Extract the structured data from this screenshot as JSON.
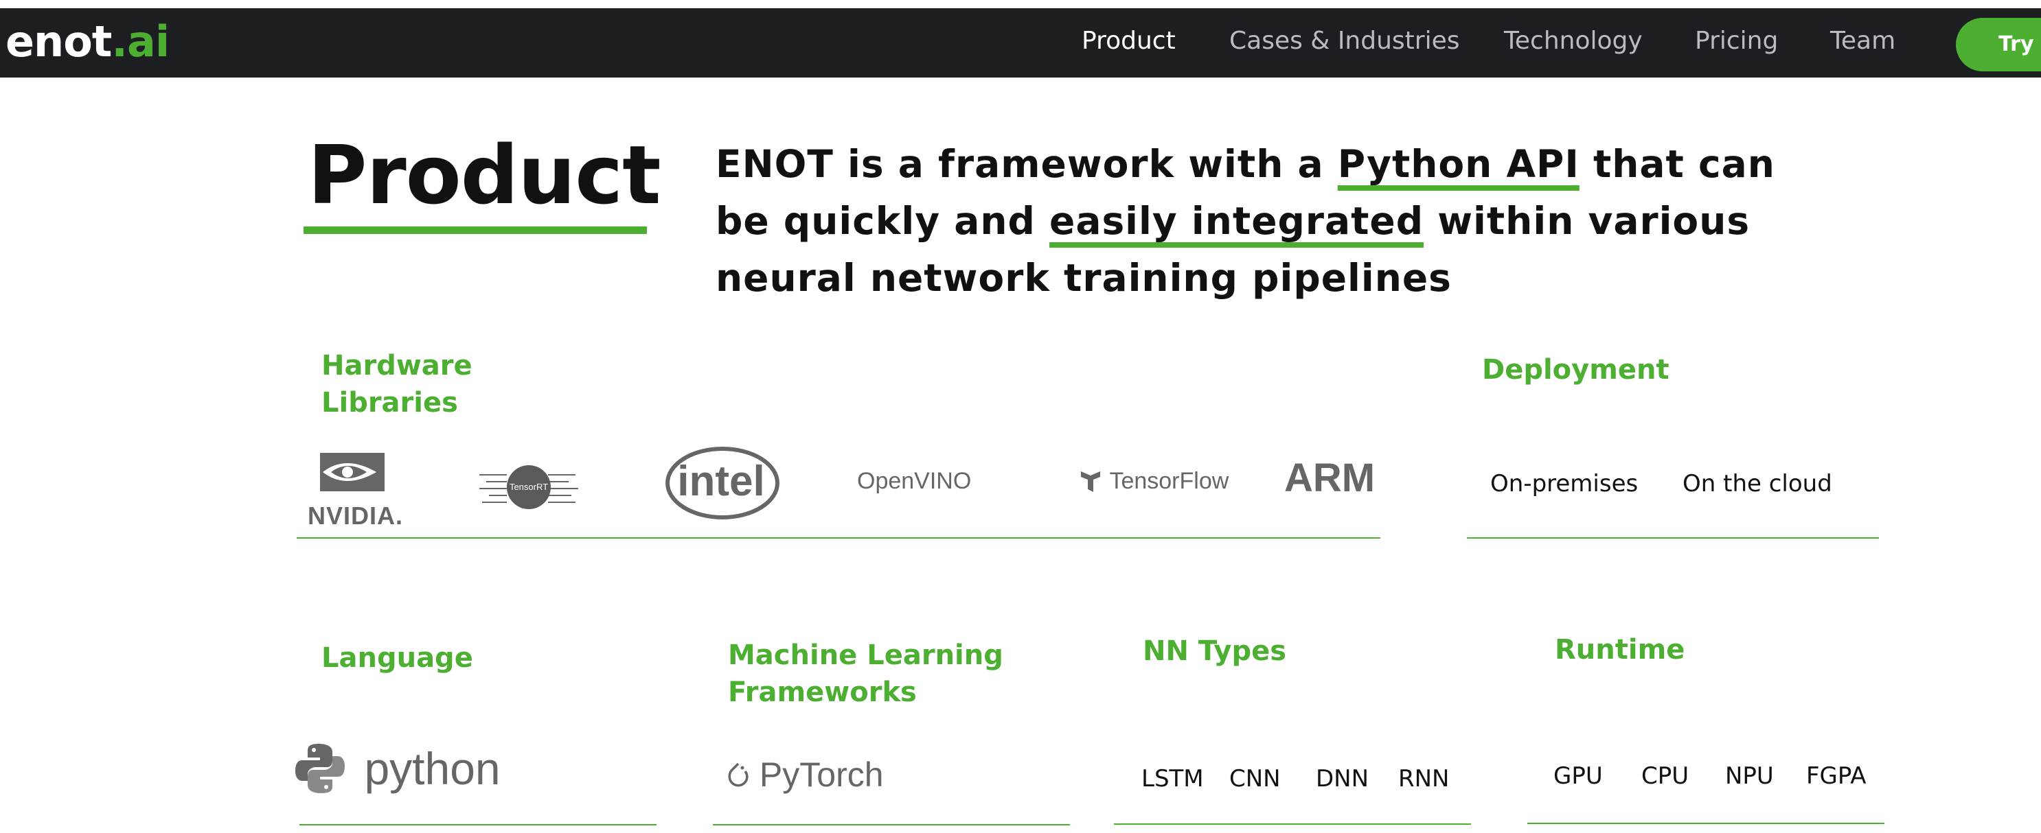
{
  "brand": {
    "name": "enot",
    "dot": ".",
    "tld": "ai"
  },
  "nav": {
    "items": [
      {
        "label": "Product"
      },
      {
        "label": "Cases & Industries"
      },
      {
        "label": "Technology"
      },
      {
        "label": "Pricing"
      },
      {
        "label": "Team"
      }
    ],
    "cta_label": "Try f"
  },
  "hero": {
    "title": "Product",
    "intro": {
      "part1": "ENOT is a framework with a ",
      "highlight1": "Python API",
      "part2": " that can be quickly and ",
      "highlight2": "easily integrated",
      "part3": " within various neural network training pipelines"
    }
  },
  "sections": {
    "hardware": {
      "heading": "Hardware Libraries",
      "logos": [
        {
          "label": "NVIDIA.",
          "icon": "nvidia-logo"
        },
        {
          "label": "TensorRT",
          "icon": "tensorrt-logo"
        },
        {
          "label": "intel",
          "icon": "intel-logo"
        },
        {
          "label": "OpenVINO",
          "icon": "openvino-logo"
        },
        {
          "label": "TensorFlow",
          "icon": "tensorflow-logo"
        },
        {
          "label": "ARM",
          "icon": "arm-logo"
        }
      ]
    },
    "deployment": {
      "heading": "Deployment",
      "items": [
        "On-premises",
        "On the cloud"
      ]
    },
    "language": {
      "heading": "Language",
      "logos": [
        {
          "label": "python",
          "icon": "python-logo"
        }
      ]
    },
    "ml_frameworks": {
      "heading": "Machine Learning Frameworks",
      "logos": [
        {
          "label": "PyTorch",
          "icon": "pytorch-logo"
        }
      ]
    },
    "nn_types": {
      "heading": "NN Types",
      "items": [
        "LSTM",
        "CNN",
        "DNN",
        "RNN"
      ]
    },
    "runtime": {
      "heading": "Runtime",
      "items": [
        "GPU",
        "CPU",
        "NPU",
        "FGPA"
      ]
    }
  },
  "colors": {
    "accent": "#4caf32",
    "navbar_bg": "#1c1e21",
    "logo_gray": "#666666"
  }
}
